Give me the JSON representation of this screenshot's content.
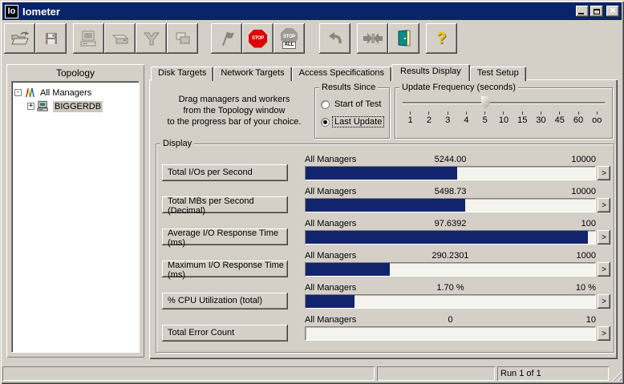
{
  "window": {
    "title": "Iometer",
    "logo": "Io"
  },
  "toolbar": {
    "stop_label": "STOP",
    "stop_all_top": "STOP",
    "stop_all_bottom": "ALL",
    "help_glyph": "?"
  },
  "topology": {
    "title": "Topology",
    "items": [
      {
        "expander": "-",
        "label": "All Managers"
      },
      {
        "expander": "+",
        "label": "BIGGERDB"
      }
    ]
  },
  "tabs": {
    "items": [
      "Disk Targets",
      "Network Targets",
      "Access Specifications",
      "Results Display",
      "Test Setup"
    ],
    "active_index": 3
  },
  "results_display": {
    "instructions": [
      "Drag managers and workers",
      "from the Topology window",
      "to the progress bar of your choice."
    ],
    "results_since": {
      "title": "Results Since",
      "options": [
        {
          "label": "Start of Test",
          "selected": false
        },
        {
          "label": "Last Update",
          "selected": true
        }
      ]
    },
    "update_frequency": {
      "title": "Update Frequency (seconds)",
      "ticks": [
        "1",
        "2",
        "3",
        "4",
        "5",
        "10",
        "15",
        "30",
        "45",
        "60",
        "oo"
      ],
      "selected_index": 4
    },
    "display": {
      "title": "Display",
      "expand_button": ">",
      "rows": [
        {
          "button": "Total I/Os per Second",
          "scope": "All Managers",
          "value": "5244.00",
          "max": "10000",
          "percent": 52.44
        },
        {
          "button": "Total MBs per Second (Decimal)",
          "scope": "All Managers",
          "value": "5498.73",
          "max": "10000",
          "percent": 54.99
        },
        {
          "button": "Average I/O Response Time (ms)",
          "scope": "All Managers",
          "value": "97.6392",
          "max": "100",
          "percent": 97.64
        },
        {
          "button": "Maximum I/O Response Time (ms)",
          "scope": "All Managers",
          "value": "290.2301",
          "max": "1000",
          "percent": 29.02
        },
        {
          "button": "% CPU Utilization (total)",
          "scope": "All Managers",
          "value": "1.70 %",
          "max": "10 %",
          "percent": 17
        },
        {
          "button": "Total Error Count",
          "scope": "All Managers",
          "value": "0",
          "max": "10",
          "percent": 0
        }
      ]
    }
  },
  "status_bar": {
    "run_text": "Run 1 of 1"
  },
  "colors": {
    "titlebar": "#0A246A",
    "chrome": "#D4D0C8",
    "progress_fill": "#13246F",
    "stop_red": "#DE0000"
  }
}
